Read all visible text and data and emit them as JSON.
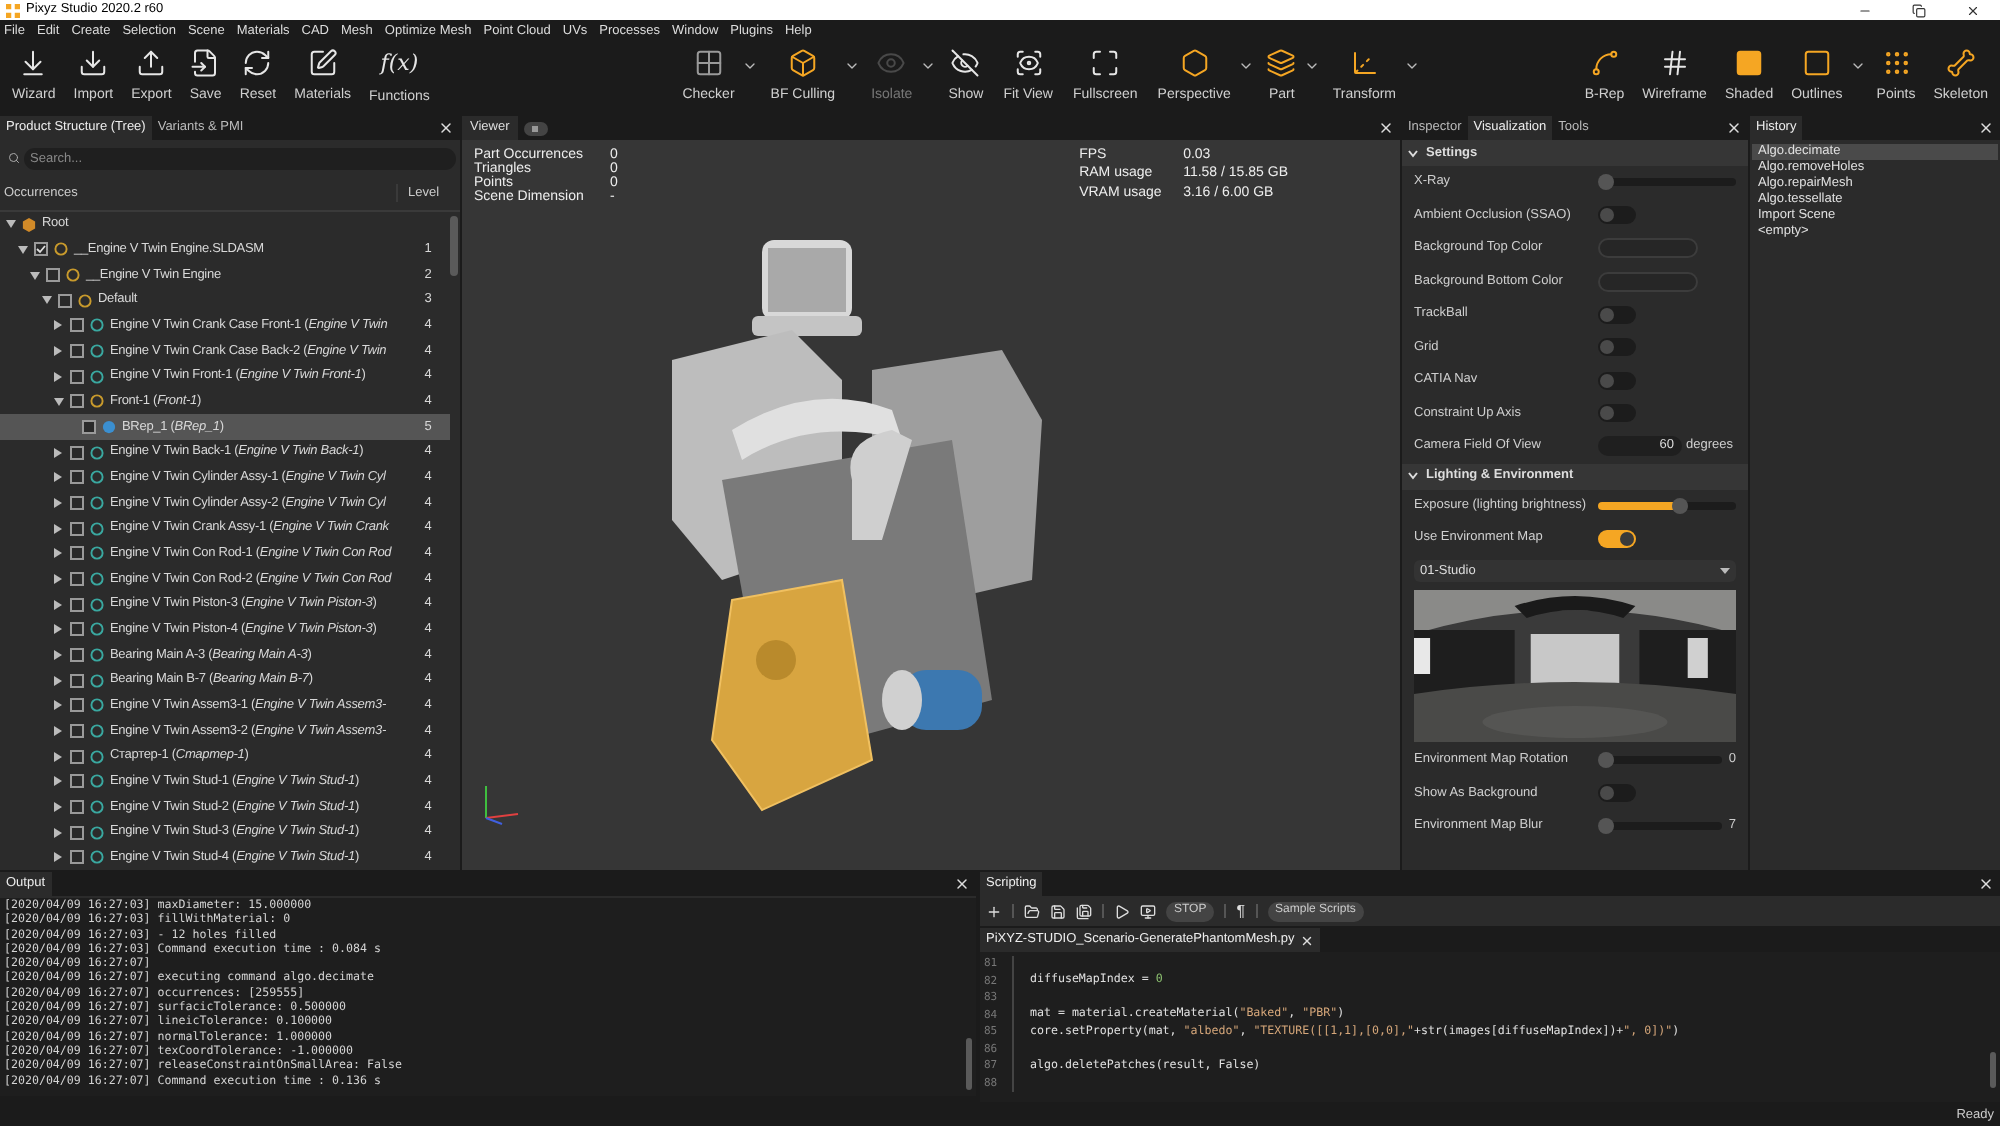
{
  "window": {
    "title": "Pixyz Studio 2020.2 r60"
  },
  "menu": [
    "File",
    "Edit",
    "Create",
    "Selection",
    "Scene",
    "Materials",
    "CAD",
    "Mesh",
    "Optimize Mesh",
    "Point Cloud",
    "UVs",
    "Processes",
    "Window",
    "Plugins",
    "Help"
  ],
  "toolbar": {
    "left": [
      {
        "label": "Wizard"
      },
      {
        "label": "Import"
      },
      {
        "label": "Export"
      },
      {
        "label": "Save"
      },
      {
        "label": "Reset"
      },
      {
        "label": "Materials"
      },
      {
        "label": "Functions",
        "glyph": "f(x)"
      }
    ],
    "center": [
      {
        "label": "Checker",
        "dropdown": true,
        "disabled": false
      },
      {
        "label": "BF Culling",
        "dropdown": true,
        "disabled": false
      },
      {
        "label": "Isolate",
        "dropdown": true,
        "disabled": true
      },
      {
        "label": "Show",
        "dropdown": false,
        "disabled": false
      },
      {
        "label": "Fit View",
        "dropdown": false,
        "disabled": false
      },
      {
        "label": "Fullscreen",
        "dropdown": false,
        "disabled": false
      },
      {
        "label": "Perspective",
        "dropdown": true,
        "disabled": false
      },
      {
        "label": "Part",
        "dropdown": true,
        "disabled": false
      },
      {
        "label": "Transform",
        "dropdown": true,
        "disabled": false
      }
    ],
    "right": [
      {
        "label": "B-Rep",
        "dropdown": false
      },
      {
        "label": "Wireframe",
        "dropdown": false
      },
      {
        "label": "Shaded",
        "dropdown": false
      },
      {
        "label": "Outlines",
        "dropdown": true
      },
      {
        "label": "Points",
        "dropdown": false
      },
      {
        "label": "Skeleton",
        "dropdown": false
      }
    ]
  },
  "tree_panel": {
    "tabs": [
      {
        "label": "Product Structure (Tree)",
        "selected": true
      },
      {
        "label": "Variants & PMI",
        "selected": false
      }
    ],
    "search": {
      "placeholder": "Search..."
    },
    "columns": [
      "Occurrences",
      "Level"
    ],
    "tree": [
      {
        "label": "Root",
        "kind": "root",
        "expanded": true,
        "selected": false,
        "children": [
          {
            "label": "__Engine V Twin Engine.SLDASM",
            "kind": "assembly",
            "level": "1",
            "expanded": true,
            "checked": true,
            "selected": false,
            "children": [
              {
                "label": "__Engine V Twin Engine",
                "kind": "assembly",
                "level": "2",
                "expanded": true,
                "checked": false,
                "selected": false,
                "children": [
                  {
                    "label": "Default",
                    "kind": "assembly",
                    "level": "3",
                    "expanded": true,
                    "checked": false,
                    "selected": false,
                    "children": [
                      {
                        "label": "Engine V Twin Crank Case Front-1 (*Engine V Twin*",
                        "kind": "part",
                        "level": "4",
                        "expanded": false,
                        "checked": false,
                        "selected": false
                      },
                      {
                        "label": "Engine V Twin Crank Case Back-2 (*Engine V Twin*",
                        "kind": "part",
                        "level": "4",
                        "expanded": false,
                        "checked": false,
                        "selected": false
                      },
                      {
                        "label": "Engine V Twin Front-1 (*Engine V Twin Front-1*)",
                        "kind": "part",
                        "level": "4",
                        "expanded": false,
                        "checked": false,
                        "selected": false
                      },
                      {
                        "label": "Front-1 (*Front-1*)",
                        "kind": "assembly",
                        "level": "4",
                        "expanded": true,
                        "checked": false,
                        "selected": false,
                        "children": [
                          {
                            "label": "BRep_1 (*BRep_1*)",
                            "kind": "brep",
                            "level": "5",
                            "checked": false,
                            "selected": true
                          }
                        ]
                      },
                      {
                        "label": "Engine V Twin Back-1 (*Engine V Twin Back-1*)",
                        "kind": "part",
                        "level": "4",
                        "expanded": false,
                        "checked": false,
                        "selected": false
                      },
                      {
                        "label": "Engine V Twin Cylinder Assy-1 (*Engine V Twin Cyl*",
                        "kind": "part",
                        "level": "4",
                        "expanded": false,
                        "checked": false,
                        "selected": false
                      },
                      {
                        "label": "Engine V Twin Cylinder Assy-2 (*Engine V Twin Cyl*",
                        "kind": "part",
                        "level": "4",
                        "expanded": false,
                        "checked": false,
                        "selected": false
                      },
                      {
                        "label": "Engine V Twin Crank Assy-1 (*Engine V Twin Crank*",
                        "kind": "part",
                        "level": "4",
                        "expanded": false,
                        "checked": false,
                        "selected": false
                      },
                      {
                        "label": "Engine V Twin Con Rod-1 (*Engine V Twin Con Rod*",
                        "kind": "part",
                        "level": "4",
                        "expanded": false,
                        "checked": false,
                        "selected": false
                      },
                      {
                        "label": "Engine V Twin Con Rod-2 (*Engine V Twin Con Rod*",
                        "kind": "part",
                        "level": "4",
                        "expanded": false,
                        "checked": false,
                        "selected": false
                      },
                      {
                        "label": "Engine V Twin Piston-3 (*Engine V Twin Piston-3*)",
                        "kind": "part",
                        "level": "4",
                        "expanded": false,
                        "checked": false,
                        "selected": false
                      },
                      {
                        "label": "Engine V Twin Piston-4 (*Engine V Twin Piston-3*)",
                        "kind": "part",
                        "level": "4",
                        "expanded": false,
                        "checked": false,
                        "selected": false
                      },
                      {
                        "label": "Bearing Main A-3 (*Bearing Main A-3*)",
                        "kind": "part",
                        "level": "4",
                        "expanded": false,
                        "checked": false,
                        "selected": false
                      },
                      {
                        "label": "Bearing Main B-7 (*Bearing Main B-7*)",
                        "kind": "part",
                        "level": "4",
                        "expanded": false,
                        "checked": false,
                        "selected": false
                      },
                      {
                        "label": "Engine V Twin Assem3-1 (*Engine V Twin Assem3-*",
                        "kind": "part",
                        "level": "4",
                        "expanded": false,
                        "checked": false,
                        "selected": false
                      },
                      {
                        "label": "Engine V Twin Assem3-2 (*Engine V Twin Assem3-*",
                        "kind": "part",
                        "level": "4",
                        "expanded": false,
                        "checked": false,
                        "selected": false
                      },
                      {
                        "label": "Стартер-1 (*Стартер-1*)",
                        "kind": "part",
                        "level": "4",
                        "expanded": false,
                        "checked": false,
                        "selected": false
                      },
                      {
                        "label": "Engine V Twin Stud-1 (*Engine V Twin Stud-1*)",
                        "kind": "part",
                        "level": "4",
                        "expanded": false,
                        "checked": false,
                        "selected": false
                      },
                      {
                        "label": "Engine V Twin Stud-2 (*Engine V Twin Stud-1*)",
                        "kind": "part",
                        "level": "4",
                        "expanded": false,
                        "checked": false,
                        "selected": false
                      },
                      {
                        "label": "Engine V Twin Stud-3 (*Engine V Twin Stud-1*)",
                        "kind": "part",
                        "level": "4",
                        "expanded": false,
                        "checked": false,
                        "selected": false
                      },
                      {
                        "label": "Engine V Twin Stud-4 (*Engine V Twin Stud-1*)",
                        "kind": "part",
                        "level": "4",
                        "expanded": false,
                        "checked": false,
                        "selected": false
                      }
                    ]
                  }
                ]
              }
            ]
          }
        ]
      }
    ]
  },
  "viewer": {
    "tab": "Viewer",
    "stats_left": [
      {
        "label": "Part Occurrences",
        "value": "0"
      },
      {
        "label": "Triangles",
        "value": "0"
      },
      {
        "label": "Points",
        "value": "0"
      },
      {
        "label": "Scene Dimension",
        "value": "-"
      }
    ],
    "stats_right": [
      {
        "label": "FPS",
        "value": "0.03"
      },
      {
        "label": "RAM usage",
        "value": "11.58 / 15.85 GB"
      },
      {
        "label": "VRAM usage",
        "value": "3.16 / 6.00 GB"
      }
    ]
  },
  "inspector": {
    "tabs": [
      {
        "label": "Inspector",
        "selected": false
      },
      {
        "label": "Visualization",
        "selected": true
      },
      {
        "label": "Tools",
        "selected": false
      }
    ],
    "sections": [
      {
        "title": "Settings",
        "expanded": true,
        "rows": [
          {
            "kind": "slider",
            "label": "X-Ray",
            "level": 0
          },
          {
            "kind": "toggle",
            "label": "Ambient Occlusion (SSAO)",
            "on": false
          },
          {
            "kind": "color",
            "label": "Background Top Color"
          },
          {
            "kind": "color",
            "label": "Background Bottom Color"
          },
          {
            "kind": "toggle",
            "label": "TrackBall",
            "on": false
          },
          {
            "kind": "toggle",
            "label": "Grid",
            "on": false
          },
          {
            "kind": "toggle",
            "label": "CATIA Nav",
            "on": false
          },
          {
            "kind": "toggle",
            "label": "Constraint Up Axis",
            "on": false
          },
          {
            "kind": "number",
            "label": "Camera Field Of View",
            "value": "60",
            "unit": "degrees"
          }
        ]
      },
      {
        "title": "Lighting & Environment",
        "expanded": true,
        "rows": [
          {
            "kind": "slider",
            "label": "Exposure (lighting brightness)",
            "level": 0.6
          },
          {
            "kind": "toggle",
            "label": "Use Environment Map",
            "on": true
          },
          {
            "kind": "dropdown",
            "value": "01-Studio"
          },
          {
            "kind": "picture"
          },
          {
            "kind": "slider",
            "label": "Environment Map Rotation",
            "level": 0,
            "reading": "0"
          },
          {
            "kind": "toggle",
            "label": "Show As Background",
            "on": false
          },
          {
            "kind": "slider",
            "label": "Environment Map Blur",
            "level": 0,
            "reading": "7"
          }
        ]
      }
    ]
  },
  "history": {
    "title": "History",
    "items": [
      {
        "label": "Algo.decimate",
        "selected": true
      },
      {
        "label": "Algo.removeHoles",
        "selected": false
      },
      {
        "label": "Algo.repairMesh",
        "selected": false
      },
      {
        "label": "Algo.tessellate",
        "selected": false
      },
      {
        "label": "Import Scene",
        "selected": false
      },
      {
        "label": "<empty>",
        "selected": false
      }
    ]
  },
  "output": {
    "title": "Output",
    "lines": [
      "[2020/04/09 16:27:03] maxDiameter: 15.000000",
      "[2020/04/09 16:27:03] fillWithMaterial: 0",
      "[2020/04/09 16:27:03] - 12 holes filled",
      "[2020/04/09 16:27:03] Command execution time : 0.084 s",
      "[2020/04/09 16:27:07]",
      "[2020/04/09 16:27:07] executing command algo.decimate",
      "[2020/04/09 16:27:07] occurrences: [259555]",
      "[2020/04/09 16:27:07] surfacicTolerance: 0.500000",
      "[2020/04/09 16:27:07] lineicTolerance: 0.100000",
      "[2020/04/09 16:27:07] normalTolerance: 1.000000",
      "[2020/04/09 16:27:07] texCoordTolerance: -1.000000",
      "[2020/04/09 16:27:07] releaseConstraintOnSmallArea: False",
      "[2020/04/09 16:27:07] Command execution time : 0.136 s"
    ]
  },
  "scripting": {
    "title": "Scripting",
    "stop_button": "STOP",
    "pilcrow": "¶",
    "sample_button": "Sample Scripts",
    "file_tab": "PiXYZ-STUDIO_Scenario-GeneratePhantomMesh.py",
    "lines": [
      {
        "number": "81"
      },
      {
        "number": "82",
        "code": [
          {
            "text": "diffuseMapIndex = ",
            "kind": "plain"
          },
          {
            "text": "0",
            "kind": "number"
          }
        ]
      },
      {
        "number": "83"
      },
      {
        "number": "84",
        "code": [
          {
            "text": "mat = material.createMaterial(",
            "kind": "plain"
          },
          {
            "text": "\"Baked\"",
            "kind": "string"
          },
          {
            "text": ", ",
            "kind": "plain"
          },
          {
            "text": "\"PBR\"",
            "kind": "string"
          },
          {
            "text": ")",
            "kind": "plain"
          }
        ]
      },
      {
        "number": "85",
        "code": [
          {
            "text": "core.setProperty(mat, ",
            "kind": "plain"
          },
          {
            "text": "\"albedo\"",
            "kind": "string"
          },
          {
            "text": ", ",
            "kind": "plain"
          },
          {
            "text": "\"TEXTURE([[1,1],[0,0],\"",
            "kind": "string"
          },
          {
            "text": "+str(images[diffuseMapIndex])+",
            "kind": "plain"
          },
          {
            "text": "\", 0])\"",
            "kind": "string"
          },
          {
            "text": ")",
            "kind": "plain"
          }
        ]
      },
      {
        "number": "86"
      },
      {
        "number": "87",
        "code": [
          {
            "text": "algo.deletePatches(result, False)",
            "kind": "plain"
          }
        ]
      },
      {
        "number": "88"
      }
    ]
  },
  "status_bar": {
    "text": "Ready"
  }
}
